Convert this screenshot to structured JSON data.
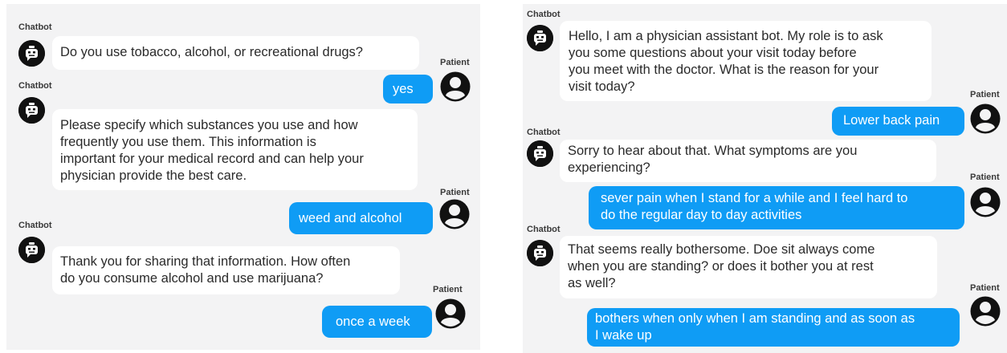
{
  "left_conversation": {
    "messages": [
      {
        "sender": "Chatbot",
        "text": "Do you use tobacco, alcohol, or recreational drugs?"
      },
      {
        "sender": "Patient",
        "text": "yes"
      },
      {
        "sender": "Chatbot",
        "text": "Please specify which substances you use and how\nfrequently you use them. This information is\nimportant for your medical record and can help your\nphysician provide the best care."
      },
      {
        "sender": "Patient",
        "text": "weed and alcohol"
      },
      {
        "sender": "Chatbot",
        "text": "Thank you for sharing that information. How often\ndo you consume alcohol and use marijuana?"
      },
      {
        "sender": "Patient",
        "text": "once a week"
      }
    ]
  },
  "right_conversation": {
    "messages": [
      {
        "sender": "Chatbot",
        "text": "Hello, I am a physician assistant bot. My role is to ask\nyou some questions about your visit today before\nyou meet with the doctor. What is the reason for your\nvisit today?"
      },
      {
        "sender": "Patient",
        "text": "Lower back pain"
      },
      {
        "sender": "Chatbot",
        "text": "Sorry to hear about that. What symptoms are you\nexperiencing?"
      },
      {
        "sender": "Patient",
        "text": "sever pain when I stand for a while and I feel hard to\ndo the regular day to day activities"
      },
      {
        "sender": "Chatbot",
        "text": "That seems really bothersome. Doe sit always come\nwhen you are standing? or does it bother you at rest\nas well?"
      },
      {
        "sender": "Patient",
        "text": "bothers when only when I am standing and as soon as\nI wake up"
      }
    ]
  },
  "icons": {
    "bot": "robot-icon",
    "patient": "user-icon"
  },
  "colors": {
    "panel_bg": "#f3f3f4",
    "user_bubble": "#0f9cf5",
    "bot_bubble": "#ffffff",
    "avatar": "#111111"
  }
}
